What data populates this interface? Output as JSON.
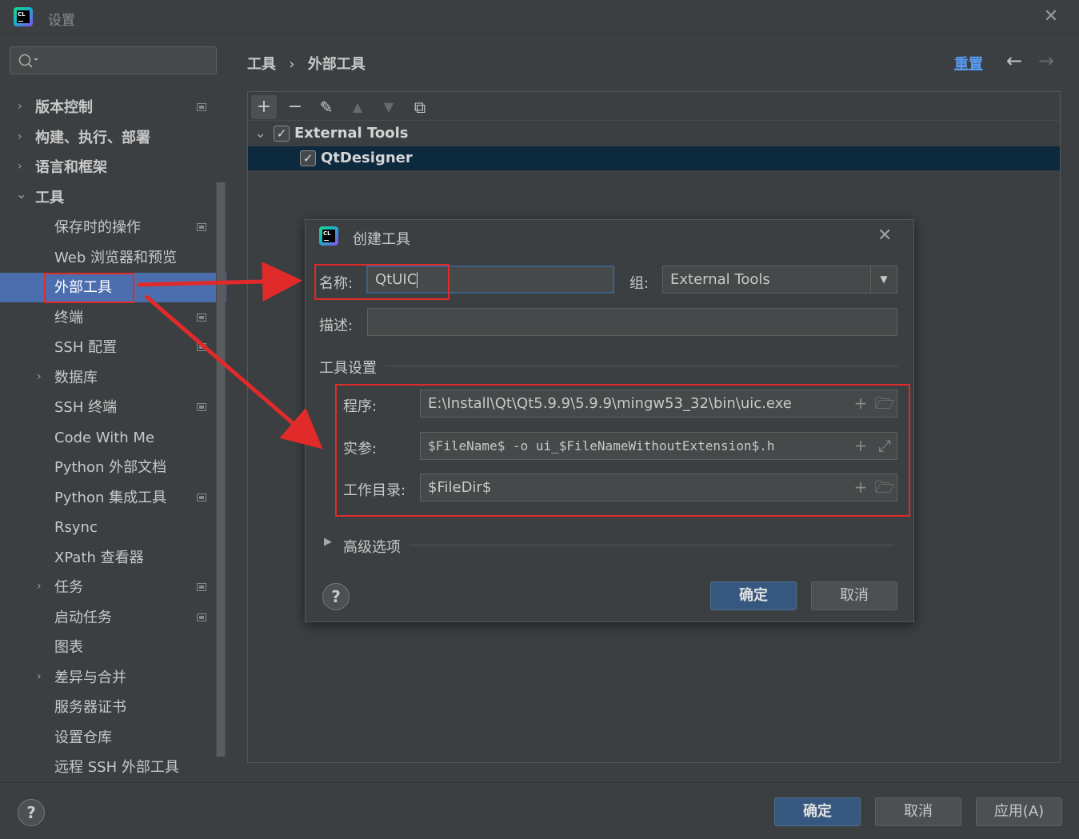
{
  "window": {
    "title": "设置",
    "close_glyph": "✕"
  },
  "sidebar": {
    "search_placeholder": "",
    "items": [
      {
        "label": "版本控制",
        "arrow": "›"
      },
      {
        "label": "构建、执行、部署",
        "arrow": "›"
      },
      {
        "label": "语言和框架",
        "arrow": "›"
      },
      {
        "label": "工具",
        "arrow": "⌄"
      },
      {
        "label": "保存时的操作"
      },
      {
        "label": "Web 浏览器和预览"
      },
      {
        "label": "外部工具"
      },
      {
        "label": "终端"
      },
      {
        "label": "SSH 配置"
      },
      {
        "label": "数据库",
        "arrow": "›"
      },
      {
        "label": "SSH 终端"
      },
      {
        "label": "Code With Me"
      },
      {
        "label": "Python 外部文档"
      },
      {
        "label": "Python 集成工具"
      },
      {
        "label": "Rsync"
      },
      {
        "label": "XPath 查看器"
      },
      {
        "label": "任务",
        "arrow": "›"
      },
      {
        "label": "启动任务"
      },
      {
        "label": "图表"
      },
      {
        "label": "差异与合并",
        "arrow": "›"
      },
      {
        "label": "服务器证书"
      },
      {
        "label": "设置仓库"
      },
      {
        "label": "远程 SSH 外部工具"
      }
    ]
  },
  "header": {
    "breadcrumb_root": "工具",
    "breadcrumb_sep": "›",
    "breadcrumb_current": "外部工具",
    "reset_label": "重置",
    "back_glyph": "←",
    "forward_glyph": "→"
  },
  "toolbar": {
    "add": "+",
    "remove": "−",
    "edit": "✎",
    "up": "▲",
    "down": "▼",
    "copy": "⧉"
  },
  "tree": {
    "group": {
      "label": "External Tools",
      "checked": "✓",
      "expander": "⌄"
    },
    "child": {
      "label": "QtDesigner",
      "checked": "✓"
    }
  },
  "dialog": {
    "title": "创建工具",
    "close_glyph": "✕",
    "name_label": "名称:",
    "name_value": "QtUIC",
    "group_label": "组:",
    "group_value": "External Tools",
    "group_dropdown_glyph": "▼",
    "desc_label": "描述:",
    "desc_value": "",
    "section_tool_settings": "工具设置",
    "program_label": "程序:",
    "program_value": "E:\\Install\\Qt\\Qt5.9.9\\5.9.9\\mingw53_32\\bin\\uic.exe",
    "args_label": "实参:",
    "args_value": "$FileName$ -o ui_$FileNameWithoutExtension$.h",
    "workdir_label": "工作目录:",
    "workdir_value": "$FileDir$",
    "plus_glyph": "+",
    "folder_glyph": "🗁",
    "expand_glyph": "⤢",
    "advanced_arrow": "▶",
    "advanced_label": "高级选项",
    "help_glyph": "?",
    "ok_label": "确定",
    "cancel_label": "取消"
  },
  "footer": {
    "help_glyph": "?",
    "ok_label": "确定",
    "cancel_label": "取消",
    "apply_label": "应用(A)"
  },
  "colors": {
    "background": "#3c3f41",
    "selection": "#4b6eaf",
    "tree_selection": "#0d293e",
    "link": "#589df6",
    "primary_button": "#365880",
    "annotation_red": "#e12a2a"
  },
  "icons": {
    "app_logo": "clion-logo-icon",
    "search": "search-icon"
  }
}
